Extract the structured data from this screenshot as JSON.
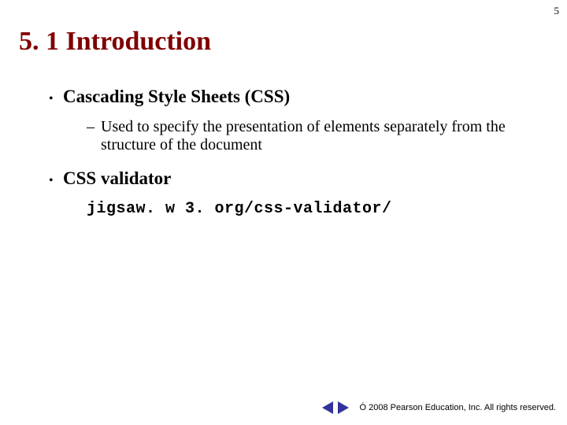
{
  "page_number": "5",
  "title": "5. 1 Introduction",
  "bullets": [
    {
      "text": "Cascading Style Sheets (CSS)",
      "sub": "Used to specify the presentation of elements separately from the structure of the document"
    },
    {
      "text": "CSS validator",
      "code": "jigsaw. w 3. org/css-validator/"
    }
  ],
  "footer": {
    "copyright_symbol": "Ó",
    "text": " 2008 Pearson Education, Inc.  All rights reserved."
  }
}
